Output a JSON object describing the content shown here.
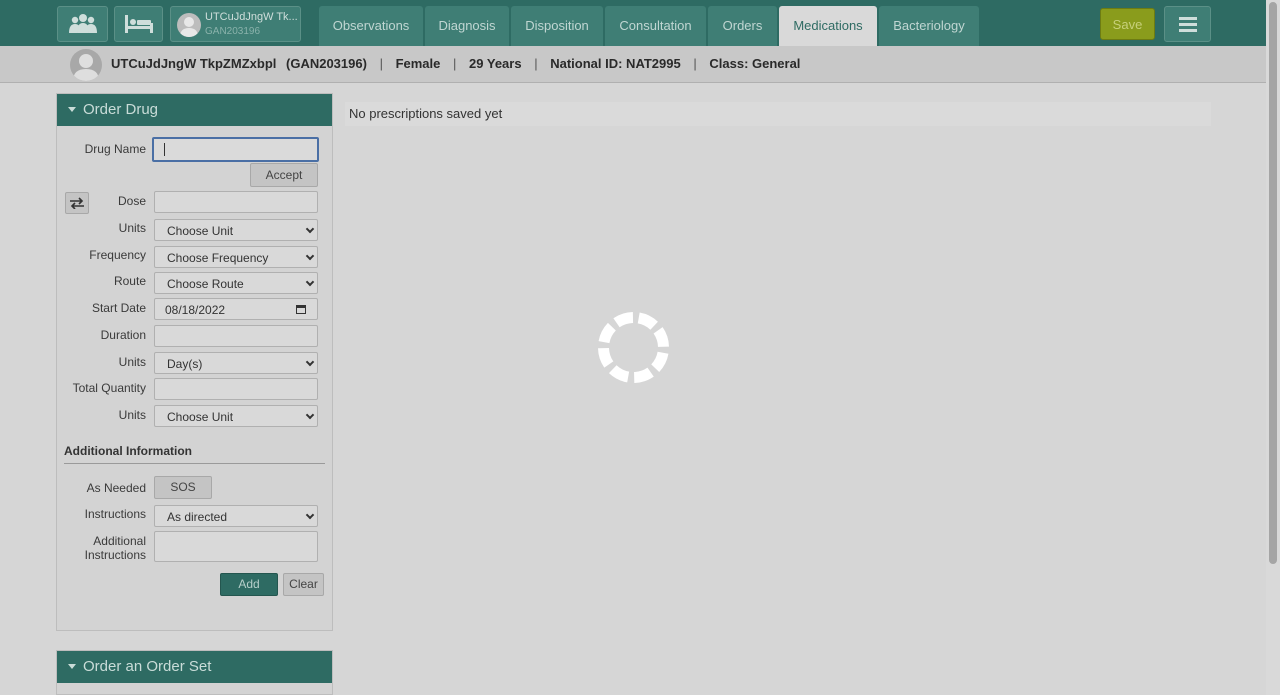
{
  "header": {
    "patient_short_name": "UTCuJdJngW Tk...",
    "patient_short_id": "GAN203196",
    "tabs": [
      {
        "label": "Observations",
        "active": false
      },
      {
        "label": "Diagnosis",
        "active": false
      },
      {
        "label": "Disposition",
        "active": false
      },
      {
        "label": "Consultation",
        "active": false
      },
      {
        "label": "Orders",
        "active": false
      },
      {
        "label": "Medications",
        "active": true
      },
      {
        "label": "Bacteriology",
        "active": false
      }
    ],
    "save_label": "Save",
    "icons": [
      "patients-icon",
      "bed-icon",
      "avatar-icon",
      "hamburger-menu-icon"
    ]
  },
  "patient": {
    "name": "UTCuJdJngW TkpZMZxbpl",
    "id": "(GAN203196)",
    "gender": "Female",
    "age": "29 Years",
    "national_id": "National ID: NAT2995",
    "class": "Class: General",
    "separator": "|"
  },
  "order_drug": {
    "title": "Order Drug",
    "drug_name_label": "Drug Name",
    "drug_name_value": "",
    "accept_label": "Accept",
    "dose_label": "Dose",
    "dose_value": "",
    "units_label": "Units",
    "units_value": "Choose Unit",
    "frequency_label": "Frequency",
    "frequency_value": "Choose Frequency",
    "route_label": "Route",
    "route_value": "Choose Route",
    "start_date_label": "Start Date",
    "start_date_value": "08/18/2022",
    "duration_label": "Duration",
    "duration_value": "",
    "duration_units_label": "Units",
    "duration_units_value": "Day(s)",
    "total_quantity_label": "Total Quantity",
    "total_quantity_value": "",
    "quantity_units_label": "Units",
    "quantity_units_value": "Choose Unit",
    "additional_info_title": "Additional Information",
    "as_needed_label": "As Needed",
    "sos_label": "SOS",
    "instructions_label": "Instructions",
    "instructions_value": "As directed",
    "additional_instructions_label_1": "Additional",
    "additional_instructions_label_2": "Instructions",
    "additional_instructions_value": "",
    "add_label": "Add",
    "clear_label": "Clear"
  },
  "order_set": {
    "title": "Order an Order Set"
  },
  "main": {
    "no_prescriptions": "No prescriptions saved yet"
  },
  "colors": {
    "header_bg": "#2e6b63",
    "save_button": "#8a9c1c",
    "active_tab_bg": "#d9d9d9"
  }
}
